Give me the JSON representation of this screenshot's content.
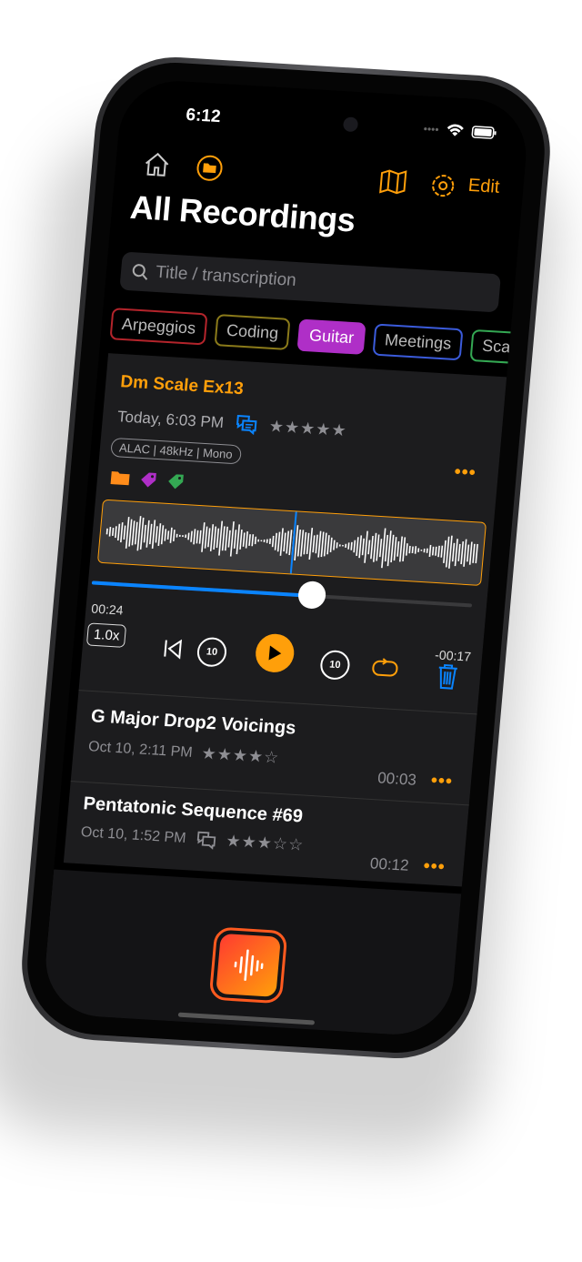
{
  "status": {
    "time": "6:12"
  },
  "nav": {
    "edit_label": "Edit",
    "icons": [
      "house-icon",
      "folder-icon",
      "map-icon",
      "gear-icon"
    ]
  },
  "header": {
    "title": "All Recordings"
  },
  "search": {
    "placeholder": "Title / transcription"
  },
  "chips": [
    {
      "label": "Arpeggios",
      "color": "#b3242b",
      "selected": false
    },
    {
      "label": "Coding",
      "color": "#8a7a1a",
      "selected": false
    },
    {
      "label": "Guitar",
      "color": "#af2fc7",
      "selected": true
    },
    {
      "label": "Meetings",
      "color": "#3b5bdb",
      "selected": false
    },
    {
      "label": "Scales",
      "color": "#34a853",
      "selected": false
    }
  ],
  "expanded": {
    "title": "Dm Scale Ex13",
    "date": "Today, 6:03 PM",
    "rating": 5,
    "stars": "★★★★★",
    "format": "ALAC | 48kHz | Mono",
    "has_transcript": true,
    "elapsed": "00:24",
    "remaining": "-00:17",
    "progress": 0.58,
    "speed": "1.0x",
    "skip_back": "10",
    "skip_forward": "10",
    "more": "•••"
  },
  "recordings": [
    {
      "title": "G Major Drop2 Voicings",
      "date": "Oct 10, 2:11 PM",
      "rating": 4,
      "stars": "★★★★☆",
      "duration": "00:03",
      "has_transcript": false,
      "more": "•••"
    },
    {
      "title": "Pentatonic Sequence #69",
      "date": "Oct 10, 1:52 PM",
      "rating": 3,
      "stars": "★★★☆☆",
      "duration": "00:12",
      "has_transcript": true,
      "more": "•••"
    }
  ],
  "colors": {
    "accent": "#ff9f0a",
    "blue": "#0a84ff",
    "background": "#000000",
    "card": "#1c1c1e"
  }
}
